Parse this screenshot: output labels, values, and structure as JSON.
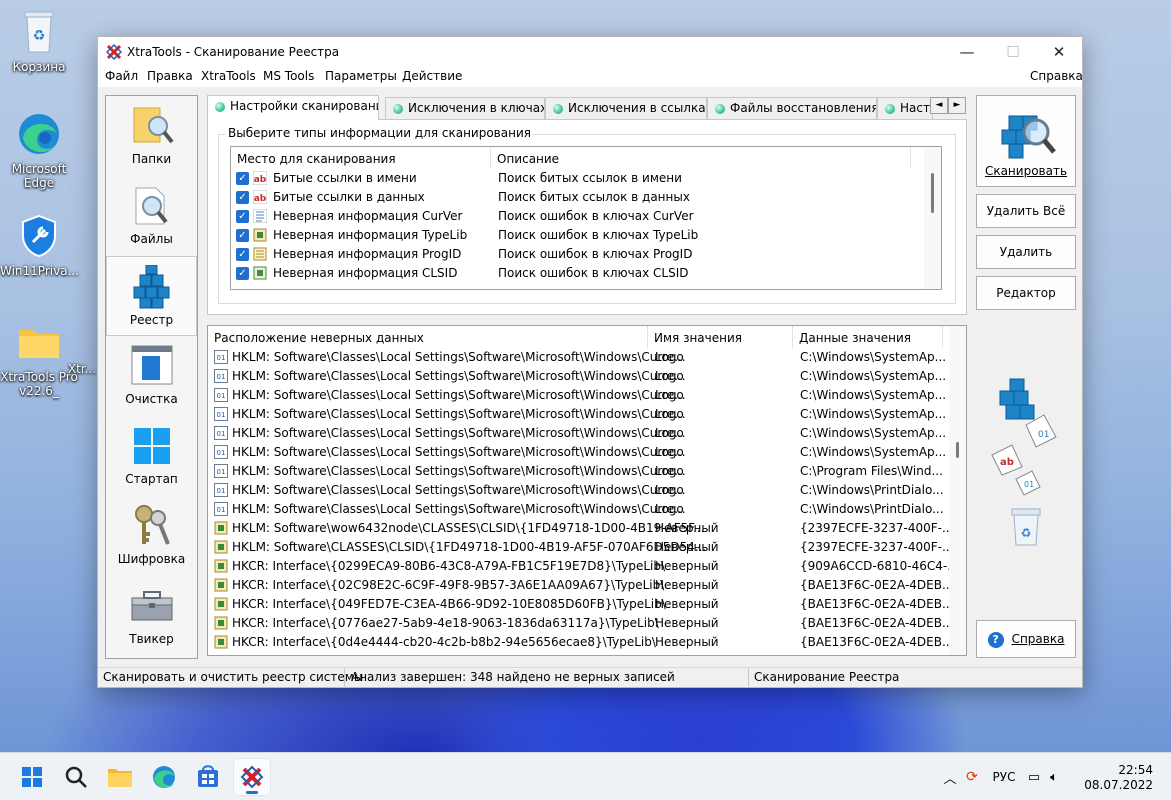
{
  "desktop": {
    "icons": [
      {
        "label": "Корзина",
        "icon": "recycle-bin-icon"
      },
      {
        "label": "Microsoft Edge",
        "icon": "edge-icon"
      },
      {
        "label": "Win11Priva...",
        "icon": "privacy-app-icon"
      },
      {
        "label": "XtraTools Pro v22.6_",
        "icon": "folder-icon"
      },
      {
        "label": "Xtr...",
        "icon": "folder-icon"
      }
    ]
  },
  "window": {
    "title": "XtraTools - Сканирование Реестра",
    "controls": {
      "minimize": "—",
      "maximize": "☐",
      "close": "✕"
    }
  },
  "menu": {
    "items": [
      "Файл",
      "Правка",
      "XtraTools",
      "MS Tools",
      "Параметры",
      "Действие"
    ],
    "help": "Справка"
  },
  "nav": {
    "items": [
      {
        "label": "Папки",
        "icon": "folder-search-icon"
      },
      {
        "label": "Файлы",
        "icon": "file-search-icon"
      },
      {
        "label": "Реестр",
        "icon": "registry-cubes-icon",
        "active": true
      },
      {
        "label": "Очистка",
        "icon": "cleanup-window-icon"
      },
      {
        "label": "Стартап",
        "icon": "windows-logo-icon"
      },
      {
        "label": "Шифровка",
        "icon": "keys-icon"
      },
      {
        "label": "Твикер",
        "icon": "toolbox-icon"
      }
    ]
  },
  "tabs": {
    "items": [
      "Настройки сканирования",
      "Исключения в ключах",
      "Исключения в ссылках",
      "Файлы восстановления",
      "Наст..."
    ],
    "scroll_left": "◄",
    "scroll_right": "►"
  },
  "scan_types": {
    "group_title": "Выберите типы информации для сканирования",
    "headers": [
      "Место для сканирования",
      "Описание"
    ],
    "rows": [
      {
        "name": "Битые ссылки в имени",
        "desc": "Поиск битых ссылок в имени",
        "checked": true,
        "icon": "ab-text-icon"
      },
      {
        "name": "Битые ссылки в данных",
        "desc": "Поиск битых ссылок в данных",
        "checked": true,
        "icon": "ab-text-icon"
      },
      {
        "name": "Неверная информация CurVer",
        "desc": "Поиск ошибок в ключах CurVer",
        "checked": true,
        "icon": "curver-icon"
      },
      {
        "name": "Неверная информация TypeLib",
        "desc": "Поиск ошибок в ключах TypeLib",
        "checked": true,
        "icon": "typelib-icon"
      },
      {
        "name": "Неверная информация ProgID",
        "desc": "Поиск ошибок в ключах ProgID",
        "checked": true,
        "icon": "progid-icon"
      },
      {
        "name": "Неверная информация CLSID",
        "desc": "Поиск ошибок в ключах CLSID",
        "checked": true,
        "icon": "clsid-icon"
      }
    ]
  },
  "results": {
    "headers": [
      "Расположение неверных данных",
      "Имя значения",
      "Данные значения"
    ],
    "rows": [
      {
        "path": "HKLM: Software\\Classes\\Local Settings\\Software\\Microsoft\\Windows\\Curre...",
        "name": "Logo",
        "data": "C:\\Windows\\SystemAp..."
      },
      {
        "path": "HKLM: Software\\Classes\\Local Settings\\Software\\Microsoft\\Windows\\Curre...",
        "name": "Logo",
        "data": "C:\\Windows\\SystemAp..."
      },
      {
        "path": "HKLM: Software\\Classes\\Local Settings\\Software\\Microsoft\\Windows\\Curre...",
        "name": "Logo",
        "data": "C:\\Windows\\SystemAp..."
      },
      {
        "path": "HKLM: Software\\Classes\\Local Settings\\Software\\Microsoft\\Windows\\Curre...",
        "name": "Logo",
        "data": "C:\\Windows\\SystemAp..."
      },
      {
        "path": "HKLM: Software\\Classes\\Local Settings\\Software\\Microsoft\\Windows\\Curre...",
        "name": "Logo",
        "data": "C:\\Windows\\SystemAp..."
      },
      {
        "path": "HKLM: Software\\Classes\\Local Settings\\Software\\Microsoft\\Windows\\Curre...",
        "name": "Logo",
        "data": "C:\\Windows\\SystemAp..."
      },
      {
        "path": "HKLM: Software\\Classes\\Local Settings\\Software\\Microsoft\\Windows\\Curre...",
        "name": "Logo",
        "data": "C:\\Program Files\\Wind..."
      },
      {
        "path": "HKLM: Software\\Classes\\Local Settings\\Software\\Microsoft\\Windows\\Curre...",
        "name": "Logo",
        "data": "C:\\Windows\\PrintDialo..."
      },
      {
        "path": "HKLM: Software\\Classes\\Local Settings\\Software\\Microsoft\\Windows\\Curre...",
        "name": "Logo",
        "data": "C:\\Windows\\PrintDialo..."
      },
      {
        "path": "HKLM: Software\\wow6432node\\CLASSES\\CLSID\\{1FD49718-1D00-4B19-AF5F...",
        "name": "Неверный",
        "data": "{2397ECFE-3237-400F-..."
      },
      {
        "path": "HKLM: Software\\CLASSES\\CLSID\\{1FD49718-1D00-4B19-AF5F-070AF6D5D54...",
        "name": "Неверный",
        "data": "{2397ECFE-3237-400F-..."
      },
      {
        "path": "HKCR: Interface\\{0299ECA9-80B6-43C8-A79A-FB1C5F19E7D8}\\TypeLib\\",
        "name": "Неверный",
        "data": "{909A6CCD-6810-46C4-..."
      },
      {
        "path": "HKCR: Interface\\{02C98E2C-6C9F-49F8-9B57-3A6E1AA09A67}\\TypeLib\\",
        "name": "Неверный",
        "data": "{BAE13F6C-0E2A-4DEB..."
      },
      {
        "path": "HKCR: Interface\\{049FED7E-C3EA-4B66-9D92-10E8085D60FB}\\TypeLib\\",
        "name": "Неверный",
        "data": "{BAE13F6C-0E2A-4DEB..."
      },
      {
        "path": "HKCR: Interface\\{0776ae27-5ab9-4e18-9063-1836da63117a}\\TypeLib\\",
        "name": "Неверный",
        "data": "{BAE13F6C-0E2A-4DEB..."
      },
      {
        "path": "HKCR: Interface\\{0d4e4444-cb20-4c2b-b8b2-94e5656ecae8}\\TypeLib\\",
        "name": "Неверный",
        "data": "{BAE13F6C-0E2A-4DEB..."
      }
    ]
  },
  "buttons": {
    "scan": "Сканировать",
    "delete_all": "Удалить Всё",
    "delete": "Удалить",
    "editor": "Редактор",
    "help": "Справка"
  },
  "status": {
    "left": "Сканировать и очистить реестр системы",
    "middle": "Анализ завершен: 348 найдено не верных записей",
    "right": "Сканирование Реестра"
  },
  "taskbar": {
    "apps": [
      "windows-start-icon",
      "search-icon",
      "file-explorer-icon",
      "edge-icon",
      "store-icon",
      "xtratools-icon"
    ],
    "tray_lang": "РУС",
    "time": "22:54",
    "date": "08.07.2022"
  },
  "colors": {
    "accent": "#1f6fd0",
    "tab_dot": "#48c9a8"
  }
}
